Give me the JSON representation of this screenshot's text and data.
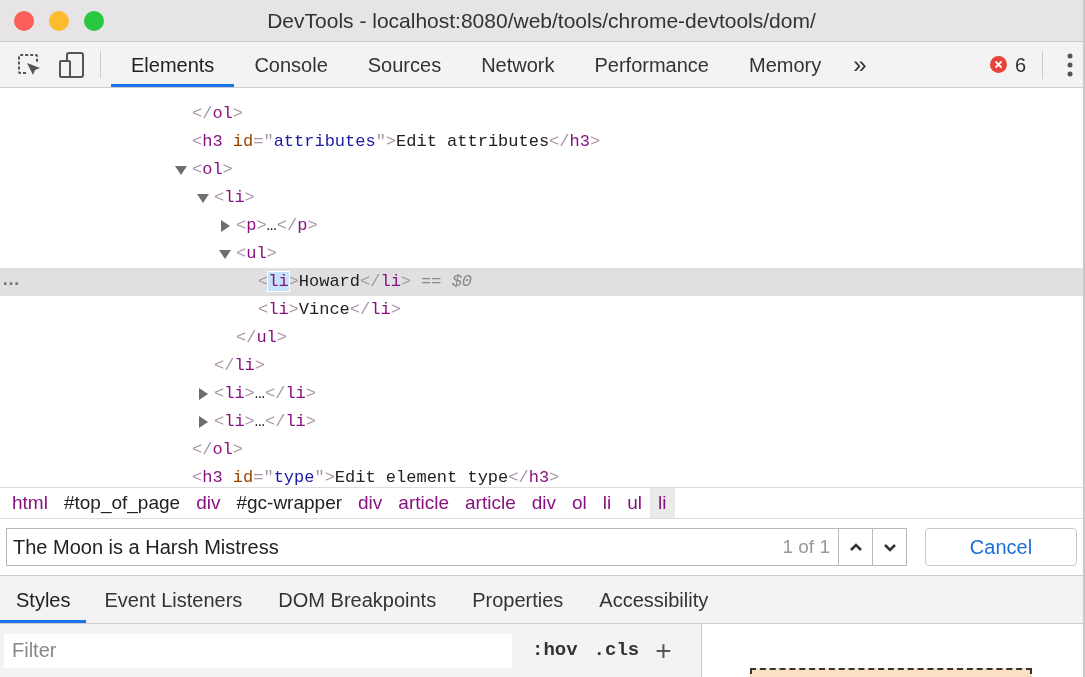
{
  "window": {
    "title": "DevTools - localhost:8080/web/tools/chrome-devtools/dom/"
  },
  "tabs": [
    {
      "label": "Elements",
      "selected": true
    },
    {
      "label": "Console",
      "selected": false
    },
    {
      "label": "Sources",
      "selected": false
    },
    {
      "label": "Network",
      "selected": false
    },
    {
      "label": "Performance",
      "selected": false
    },
    {
      "label": "Memory",
      "selected": false
    }
  ],
  "more_tabs": "»",
  "error_count": "6",
  "dom_tree": [
    {
      "closing_line": "</ol>",
      "selected": false
    },
    {
      "line": "<h3 id=\"attributes\">Edit attributes</h3>",
      "selected": false
    },
    {
      "line": "<ol>",
      "expanded": true,
      "selected": false,
      "closing_line": "</ol>",
      "children": [
        {
          "line": "<li>",
          "expanded": true,
          "selected": false,
          "closing_line": "</li>",
          "children": [
            {
              "line": "<p>…</p>",
              "expanded": false,
              "selected": false
            },
            {
              "line": "<ul>",
              "expanded": true,
              "selected": false,
              "closing_line": "</ul>",
              "children": [
                {
                  "line": "<li>Howard</li>",
                  "selected": true,
                  "tag_highlighted": true,
                  "console_ref": "== $0"
                },
                {
                  "line": "<li>Vince</li>",
                  "selected": false
                }
              ]
            }
          ]
        },
        {
          "line": "<li>…</li>",
          "expanded": false,
          "selected": false
        },
        {
          "line": "<li>…</li>",
          "expanded": false,
          "selected": false
        }
      ]
    },
    {
      "line": "<h3 id=\"type\">Edit element type</h3>",
      "selected": false
    }
  ],
  "row_menu": "…",
  "breadcrumbs": [
    {
      "kind": "tag",
      "label": "html",
      "selected": false
    },
    {
      "kind": "id",
      "label": "#top_of_page",
      "selected": false
    },
    {
      "kind": "tag",
      "label": "div",
      "selected": false
    },
    {
      "kind": "id",
      "label": "#gc-wrapper",
      "selected": false
    },
    {
      "kind": "tag",
      "label": "div",
      "selected": false
    },
    {
      "kind": "tag",
      "label": "article",
      "selected": false
    },
    {
      "kind": "tag",
      "label": "article",
      "selected": false
    },
    {
      "kind": "tag",
      "label": "div",
      "selected": false
    },
    {
      "kind": "tag",
      "label": "ol",
      "selected": false
    },
    {
      "kind": "tag",
      "label": "li",
      "selected": false
    },
    {
      "kind": "tag",
      "label": "ul",
      "selected": false
    },
    {
      "kind": "tag",
      "label": "li",
      "selected": true
    }
  ],
  "search": {
    "value": "The Moon is a Harsh Mistress",
    "match_count": "1 of 1",
    "cancel": "Cancel"
  },
  "panel_tabs": [
    {
      "label": "Styles",
      "selected": true
    },
    {
      "label": "Event Listeners",
      "selected": false
    },
    {
      "label": "DOM Breakpoints",
      "selected": false
    },
    {
      "label": "Properties",
      "selected": false
    },
    {
      "label": "Accessibility",
      "selected": false
    }
  ],
  "styles_filter": {
    "placeholder": "Filter",
    "hov": ":hov",
    "cls": ".cls",
    "add": "+"
  }
}
